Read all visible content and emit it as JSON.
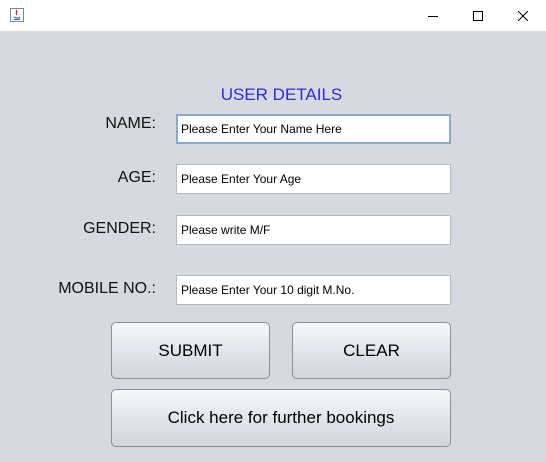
{
  "window": {
    "minimize_glyph": "—",
    "maximize_glyph": "☐",
    "close_glyph": "✕"
  },
  "form": {
    "title": "USER DETAILS",
    "name_label": "NAME:",
    "name_value": "Please Enter Your Name Here",
    "age_label": "AGE:",
    "age_value": "Please Enter Your Age",
    "gender_label": "GENDER:",
    "gender_value": "Please write M/F",
    "mobile_label": "MOBILE NO.:",
    "mobile_value": "Please Enter Your 10 digit M.No."
  },
  "buttons": {
    "submit": "SUBMIT",
    "clear": "CLEAR",
    "further": "Click here for further bookings"
  },
  "colors": {
    "background": "#d6d9e0",
    "heading": "#2b2bd9",
    "focus_border": "#8ba9cc"
  }
}
